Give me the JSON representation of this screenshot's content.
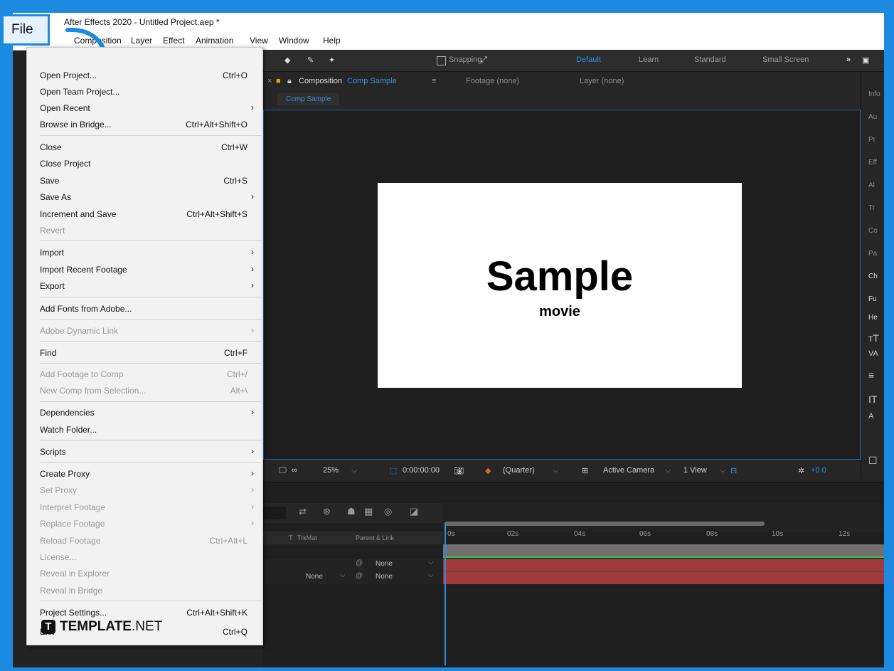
{
  "window": {
    "title": "After Effects 2020 - Untitled Project.aep *"
  },
  "menubar": {
    "file": "File",
    "items": [
      "Composition",
      "Layer",
      "Effect",
      "Animation",
      "View",
      "Window",
      "Help"
    ]
  },
  "toolbar": {
    "snapping": "Snapping",
    "workspaces": [
      "Default",
      "Learn",
      "Standard",
      "Small Screen"
    ],
    "more": "»"
  },
  "composition_panel": {
    "tab_prefix": "Composition",
    "tab_name": "Comp Sample",
    "footage_tab": "Footage (none)",
    "layer_tab": "Layer (none)",
    "comp_chip": "Comp Sample",
    "canvas_title": "Sample",
    "canvas_subtitle": "movie"
  },
  "viewer_footer": {
    "zoom": "25%",
    "timecode": "0:00:00:00",
    "resolution": "(Quarter)",
    "camera": "Active Camera",
    "views": "1 View",
    "exposure": "+0.0"
  },
  "right_panel": {
    "tabs": [
      "Info",
      "Au",
      "Pr",
      "Eff",
      "Al",
      "Tr",
      "Co",
      "Pa",
      "Ch",
      "Fu",
      "He"
    ]
  },
  "timeline": {
    "columns": {
      "t": "T",
      "trkmat": "TrkMat",
      "parent": "Parent & Link"
    },
    "rows": [
      {
        "trkmat": "",
        "parent": "None"
      },
      {
        "trkmat": "None",
        "parent": "None"
      }
    ],
    "ruler_ticks": [
      "0s",
      "02s",
      "04s",
      "06s",
      "08s",
      "10s",
      "12s"
    ]
  },
  "file_menu": {
    "items": [
      {
        "label": "Open Project...",
        "shortcut": "Ctrl+O"
      },
      {
        "label": "Open Team Project...",
        "shortcut": ""
      },
      {
        "label": "Open Recent",
        "shortcut": "",
        "submenu": true
      },
      {
        "label": "Browse in Bridge...",
        "shortcut": "Ctrl+Alt+Shift+O"
      },
      {
        "label": "Close",
        "shortcut": "Ctrl+W"
      },
      {
        "label": "Close Project",
        "shortcut": ""
      },
      {
        "label": "Save",
        "shortcut": "Ctrl+S"
      },
      {
        "label": "Save As",
        "shortcut": "",
        "submenu": true
      },
      {
        "label": "Increment and Save",
        "shortcut": "Ctrl+Alt+Shift+S"
      },
      {
        "label": "Revert",
        "shortcut": "",
        "disabled": true
      },
      {
        "label": "Import",
        "shortcut": "",
        "submenu": true
      },
      {
        "label": "Import Recent Footage",
        "shortcut": "",
        "submenu": true
      },
      {
        "label": "Export",
        "shortcut": "",
        "submenu": true
      },
      {
        "label": "Add Fonts from Adobe...",
        "shortcut": ""
      },
      {
        "label": "Adobe Dynamic Link",
        "shortcut": "",
        "submenu": true,
        "disabled": true
      },
      {
        "label": "Find",
        "shortcut": "Ctrl+F"
      },
      {
        "label": "Add Footage to Comp",
        "shortcut": "Ctrl+/",
        "disabled": true
      },
      {
        "label": "New Comp from Selection...",
        "shortcut": "Alt+\\",
        "disabled": true
      },
      {
        "label": "Dependencies",
        "shortcut": "",
        "submenu": true
      },
      {
        "label": "Watch Folder...",
        "shortcut": ""
      },
      {
        "label": "Scripts",
        "shortcut": "",
        "submenu": true
      },
      {
        "label": "Create Proxy",
        "shortcut": "",
        "submenu": true
      },
      {
        "label": "Set Proxy",
        "shortcut": "",
        "submenu": true,
        "disabled": true
      },
      {
        "label": "Interpret Footage",
        "shortcut": "",
        "submenu": true,
        "disabled": true
      },
      {
        "label": "Replace Footage",
        "shortcut": "",
        "submenu": true,
        "disabled": true
      },
      {
        "label": "Reload Footage",
        "shortcut": "Ctrl+Alt+L",
        "disabled": true
      },
      {
        "label": "License...",
        "shortcut": "",
        "disabled": true
      },
      {
        "label": "Reveal in Explorer",
        "shortcut": "",
        "disabled": true
      },
      {
        "label": "Reveal in Bridge",
        "shortcut": "",
        "disabled": true
      },
      {
        "label": "Project Settings...",
        "shortcut": "Ctrl+Alt+Shift+K"
      },
      {
        "label": "Exit",
        "shortcut": "Ctrl+Q"
      }
    ]
  },
  "watermark": {
    "logo_letter": "T",
    "brand_bold": "TEMPLATE",
    "brand_light": ".NET"
  },
  "colors": {
    "frame": "#1b8ae0",
    "accent": "#2f8be6",
    "track": "#9e3a3a"
  }
}
